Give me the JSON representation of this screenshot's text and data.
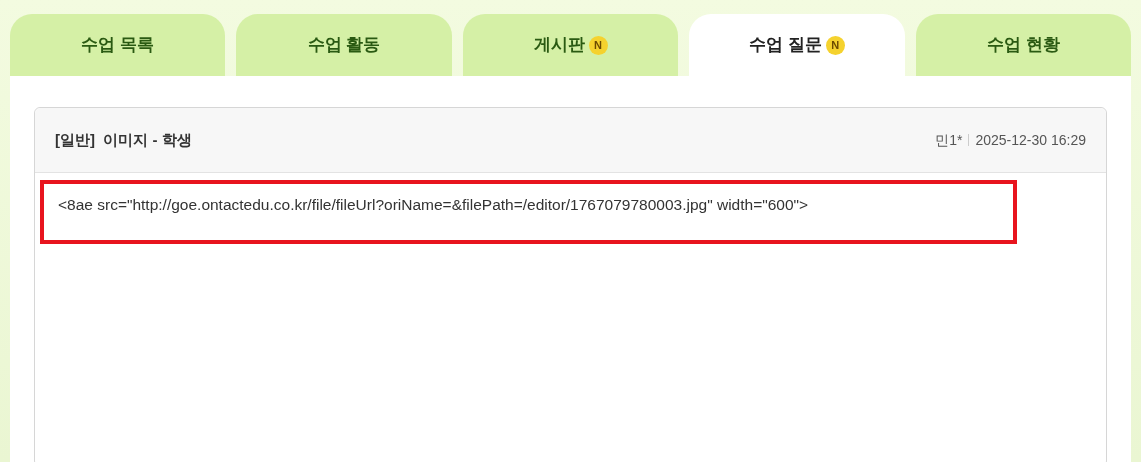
{
  "tabs": [
    {
      "label": "수업 목록",
      "selected": false
    },
    {
      "label": "수업 활동",
      "selected": false
    },
    {
      "label": "게시판",
      "selected": false,
      "new_badge": "N"
    },
    {
      "label": "수업 질문",
      "selected": true,
      "new_badge": "N"
    },
    {
      "label": "수업 현황",
      "selected": false
    }
  ],
  "post": {
    "title": "[일반]  이미지 - 학생",
    "author": "민1*",
    "date": "2025-12-30 16:29",
    "body": "<8ae src=\"http://goe.ontactedu.co.kr/file/fileUrl?oriName=&filePath=/editor/1767079780003.jpg\" width=\"600\">",
    "body_highlighted": true
  }
}
